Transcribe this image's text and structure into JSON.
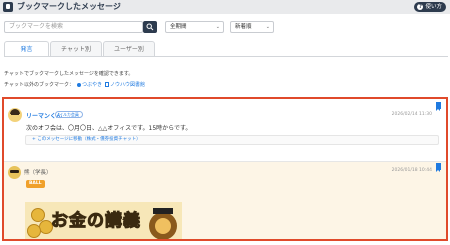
{
  "header": {
    "title": "ブックマークしたメッセージ",
    "help_label": "使い方",
    "help_icon": "question-icon",
    "logo_icon": "bookmark-app-icon"
  },
  "filters": {
    "search_placeholder": "ブックマークを検索",
    "search_icon": "search-icon",
    "period_select": "全期間",
    "sort_select": "新着順"
  },
  "tabs": [
    {
      "label": "発言",
      "active": true
    },
    {
      "label": "チャット別",
      "active": false
    },
    {
      "label": "ユーザー別",
      "active": false
    }
  ],
  "info": {
    "description": "チャットでブックマークしたメッセージを確認できます。",
    "other_label": "チャット以外のブックマーク：",
    "link_tsubuyaki": "つぶやき",
    "link_knowhow": "ノウハウ図書館"
  },
  "messages": [
    {
      "author": "リーマンくん",
      "badge": "イルカ会員",
      "timestamp": "2026/02/14 11:30",
      "text": "次のオフ会は、〇月〇日、△△オフィスです。15時からです。",
      "jump_link": "+ このメッセージに移動（株式・債券投資チャット）",
      "bookmarked": true
    },
    {
      "author": "熊（学長）",
      "timestamp": "2026/01/18 10:44",
      "tag": "BALL",
      "image_alt": "お金の講義",
      "bookmarked": true
    }
  ],
  "colors": {
    "accent": "#1f7ae0",
    "header_dark": "#2d3b4e",
    "highlight_border": "#e04a2b",
    "tag_orange": "#f0a02a"
  }
}
